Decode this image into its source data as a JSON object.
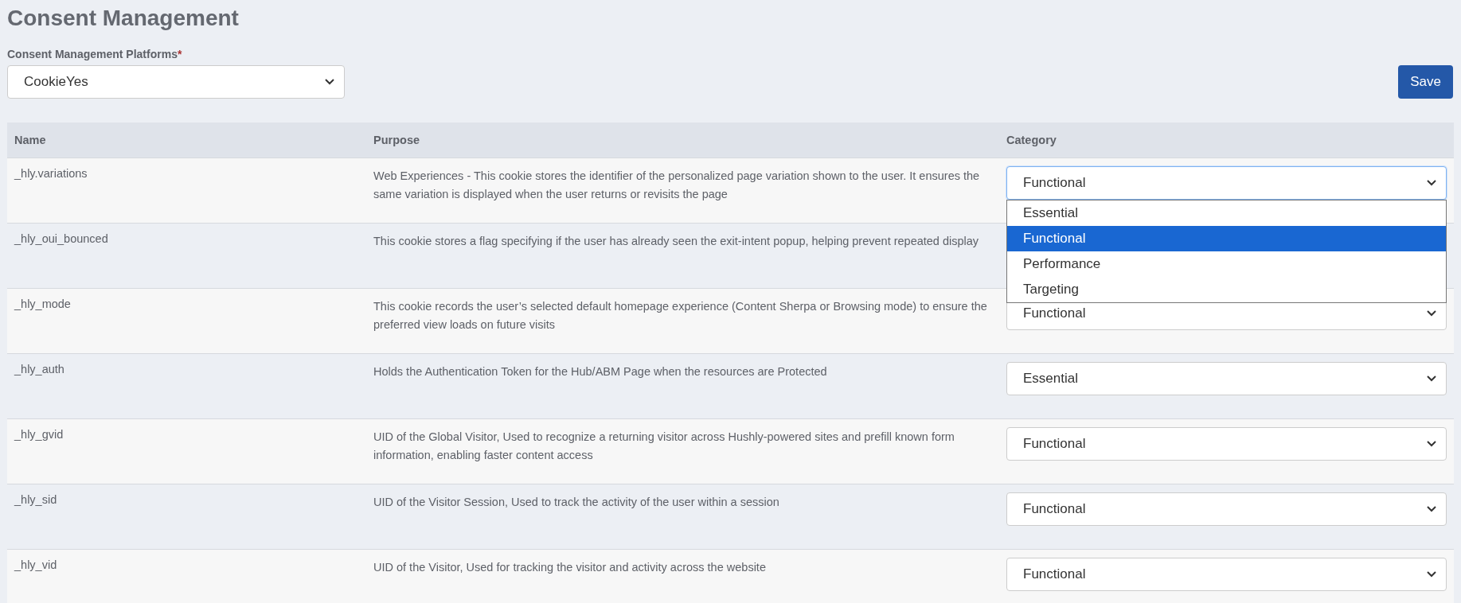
{
  "title": "Consent Management",
  "platform": {
    "label": "Consent Management Platforms",
    "required_mark": "*",
    "value": "CookieYes"
  },
  "save_button": "Save",
  "table": {
    "columns": [
      "Name",
      "Purpose",
      "Category"
    ],
    "rows": [
      {
        "name": "_hly.variations",
        "purpose": "Web Experiences - This cookie stores the identifier of the personalized page variation shown to the user. It ensures the same variation is displayed when the user returns or revisits the page",
        "category": {
          "value": "Functional",
          "expanded": true,
          "options": [
            {
              "label": "Essential",
              "selected": false
            },
            {
              "label": "Functional",
              "selected": true
            },
            {
              "label": "Performance",
              "selected": false
            },
            {
              "label": "Targeting",
              "selected": false
            }
          ]
        }
      },
      {
        "name": "_hly_oui_bounced",
        "purpose": "This cookie stores a flag specifying if the user has already seen the exit-intent popup, helping prevent repeated display"
      },
      {
        "name": "_hly_mode",
        "purpose": "This cookie records the user’s selected default homepage experience (Content Sherpa or Browsing mode) to ensure the preferred view loads on future visits",
        "category": {
          "value": "Functional",
          "expanded": false
        }
      },
      {
        "name": "_hly_auth",
        "purpose": "Holds the Authentication Token for the Hub/ABM Page when the resources are Protected",
        "category": {
          "value": "Essential",
          "expanded": false
        }
      },
      {
        "name": "_hly_gvid",
        "purpose": "UID of the Global Visitor, Used to recognize a returning visitor across Hushly-powered sites and prefill known form information, enabling faster content access",
        "category": {
          "value": "Functional",
          "expanded": false
        }
      },
      {
        "name": "_hly_sid",
        "purpose": "UID of the Visitor Session, Used to track the activity of the user within a session",
        "category": {
          "value": "Functional",
          "expanded": false
        }
      },
      {
        "name": "_hly_vid",
        "purpose": "UID of the Visitor, Used for tracking the visitor and activity across the website",
        "category": {
          "value": "Functional",
          "expanded": false
        }
      }
    ]
  }
}
